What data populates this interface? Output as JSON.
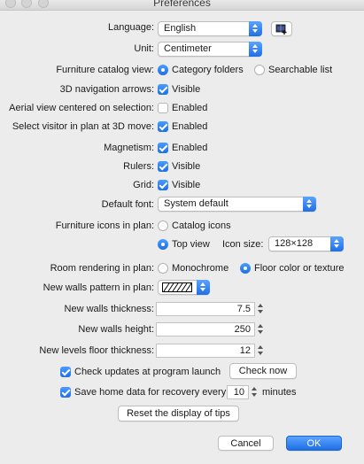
{
  "window": {
    "title": "Preferences"
  },
  "language": {
    "label": "Language:",
    "value": "English"
  },
  "unit": {
    "label": "Unit:",
    "value": "Centimeter"
  },
  "catalog_view": {
    "label": "Furniture catalog view:",
    "options": [
      "Category folders",
      "Searchable list"
    ],
    "selected": "Category folders"
  },
  "nav_arrows": {
    "label": "3D navigation arrows:",
    "option": "Visible",
    "checked": true
  },
  "aerial_view": {
    "label": "Aerial view centered on selection:",
    "option": "Enabled",
    "checked": false
  },
  "select_visitor": {
    "label": "Select visitor in plan at 3D move:",
    "option": "Enabled",
    "checked": true
  },
  "magnetism": {
    "label": "Magnetism:",
    "option": "Enabled",
    "checked": true
  },
  "rulers": {
    "label": "Rulers:",
    "option": "Visible",
    "checked": true
  },
  "grid": {
    "label": "Grid:",
    "option": "Visible",
    "checked": true
  },
  "default_font": {
    "label": "Default font:",
    "value": "System default"
  },
  "furniture_icons": {
    "label": "Furniture icons in plan:",
    "options": [
      "Catalog icons",
      "Top view"
    ],
    "selected": "Top view",
    "icon_size_label": "Icon size:",
    "icon_size_value": "128×128"
  },
  "room_rendering": {
    "label": "Room rendering in plan:",
    "options": [
      "Monochrome",
      "Floor color or texture"
    ],
    "selected": "Floor color or texture"
  },
  "walls_pattern": {
    "label": "New walls pattern in plan:"
  },
  "walls_thickness": {
    "label": "New walls thickness:",
    "value": "7.5"
  },
  "walls_height": {
    "label": "New walls height:",
    "value": "250"
  },
  "levels_floor": {
    "label": "New levels floor thickness:",
    "value": "12"
  },
  "check_updates": {
    "label": "Check updates at program launch",
    "checked": true,
    "button": "Check now"
  },
  "save_recovery": {
    "label": "Save home data for recovery every:",
    "checked": true,
    "value": "10",
    "unit": "minutes"
  },
  "reset_tips": {
    "label": "Reset the display of tips"
  },
  "footer": {
    "cancel": "Cancel",
    "ok": "OK"
  },
  "colors": {
    "accent": "#1f6fe5",
    "background": "#ececec"
  }
}
